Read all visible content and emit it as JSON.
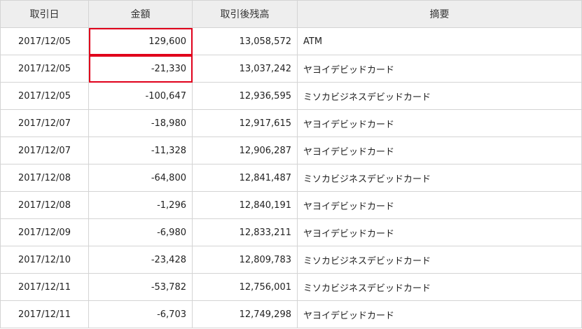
{
  "table": {
    "headers": {
      "date": "取引日",
      "amount": "金額",
      "balance": "取引後残高",
      "memo": "摘要"
    },
    "rows": [
      {
        "date": "2017/12/05",
        "amount": "129,600",
        "balance": "13,058,572",
        "memo": "ATM"
      },
      {
        "date": "2017/12/05",
        "amount": "-21,330",
        "balance": "13,037,242",
        "memo": "ヤヨイデビッドカード"
      },
      {
        "date": "2017/12/05",
        "amount": "-100,647",
        "balance": "12,936,595",
        "memo": "ミソカビジネスデビッドカード"
      },
      {
        "date": "2017/12/07",
        "amount": "-18,980",
        "balance": "12,917,615",
        "memo": "ヤヨイデビッドカード"
      },
      {
        "date": "2017/12/07",
        "amount": "-11,328",
        "balance": "12,906,287",
        "memo": "ヤヨイデビッドカード"
      },
      {
        "date": "2017/12/08",
        "amount": "-64,800",
        "balance": "12,841,487",
        "memo": "ミソカビジネスデビッドカード"
      },
      {
        "date": "2017/12/08",
        "amount": "-1,296",
        "balance": "12,840,191",
        "memo": "ヤヨイデビッドカード"
      },
      {
        "date": "2017/12/09",
        "amount": "-6,980",
        "balance": "12,833,211",
        "memo": "ヤヨイデビッドカード"
      },
      {
        "date": "2017/12/10",
        "amount": "-23,428",
        "balance": "12,809,783",
        "memo": "ミソカビジネスデビッドカード"
      },
      {
        "date": "2017/12/11",
        "amount": "-53,782",
        "balance": "12,756,001",
        "memo": "ミソカビジネスデビッドカード"
      },
      {
        "date": "2017/12/11",
        "amount": "-6,703",
        "balance": "12,749,298",
        "memo": "ヤヨイデビッドカード"
      }
    ]
  },
  "highlight": {
    "color": "#e0001b",
    "rows": [
      0,
      1
    ],
    "column": "amount"
  }
}
